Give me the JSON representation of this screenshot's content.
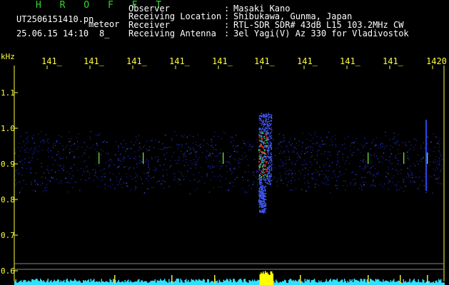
{
  "header": {
    "logo": "H R O F F T",
    "filename": "UT2506151410.pn_",
    "tag": "meteor",
    "datetime": "25.06.15 14:10",
    "extra": "8_",
    "rows": [
      {
        "label": "Observer",
        "value": "Masaki Kano"
      },
      {
        "label": "Receiving Location",
        "value": "Shibukawa, Gunma, Japan"
      },
      {
        "label": "Receiver",
        "value": "RTL-SDR SDR# 43dB L15 103.2MHz CW"
      },
      {
        "label": "Receiving Antenna",
        "value": "3el Yagi(V) Az 330 for Vladivostok"
      }
    ]
  },
  "axes": {
    "y_unit": "kHz",
    "y_ticks": [
      "1.1",
      "1.0",
      "0.9",
      "0.8",
      "0.7",
      "0.6"
    ],
    "x_ticks": [
      "141_",
      "141_",
      "141_",
      "141_",
      "141_",
      "141_",
      "141_",
      "141_",
      "141_",
      "1420"
    ]
  },
  "colors": {
    "background": "#000000",
    "axis_text": "#ffff40",
    "logo": "#2fd82f",
    "noise": "#2030c0",
    "signal_hot": "#ff3020",
    "level_bar": "#30e0ff",
    "level_peak": "#ffff00"
  }
}
